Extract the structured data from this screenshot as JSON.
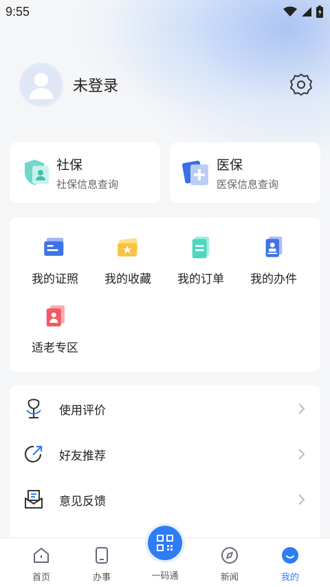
{
  "status_bar": {
    "time": "9:55"
  },
  "profile": {
    "login_text": "未登录"
  },
  "insurance": [
    {
      "title": "社保",
      "subtitle": "社保信息查询"
    },
    {
      "title": "医保",
      "subtitle": "医保信息查询"
    }
  ],
  "services": [
    {
      "label": "我的证照",
      "icon": "id-card-icon"
    },
    {
      "label": "我的收藏",
      "icon": "ticket-star-icon"
    },
    {
      "label": "我的订单",
      "icon": "document-icon"
    },
    {
      "label": "我的办件",
      "icon": "stamp-icon"
    },
    {
      "label": "适老专区",
      "icon": "elderly-icon"
    }
  ],
  "menu": [
    {
      "label": "使用评价",
      "icon": "flower-icon"
    },
    {
      "label": "好友推荐",
      "icon": "share-arrow-icon"
    },
    {
      "label": "意见反馈",
      "icon": "feedback-mail-icon"
    }
  ],
  "tabs": [
    {
      "label": "首页",
      "icon": "home-icon"
    },
    {
      "label": "办事",
      "icon": "phone-icon"
    },
    {
      "label": "一码通",
      "icon": "qr-code-icon"
    },
    {
      "label": "新闻",
      "icon": "compass-icon"
    },
    {
      "label": "我的",
      "icon": "profile-icon"
    }
  ],
  "colors": {
    "accent": "#2e7df5",
    "background": "#f5f6f8"
  }
}
